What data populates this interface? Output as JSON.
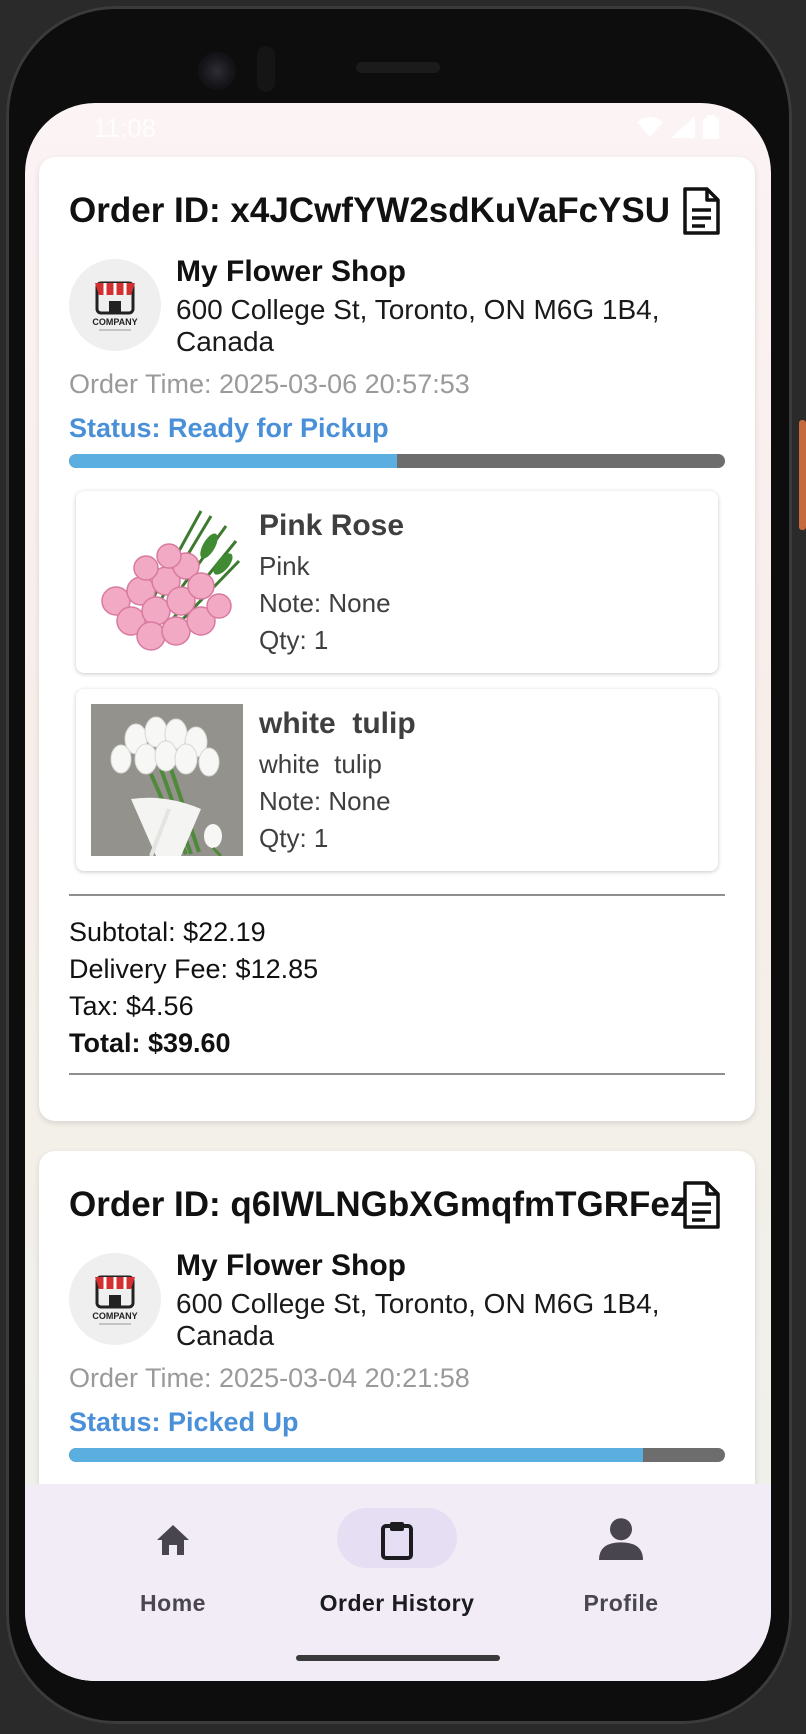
{
  "status_bar": {
    "time": "11:08"
  },
  "orders": [
    {
      "title": "Order ID: x4JCwfYW2sdKuVaFcYSU",
      "shop": {
        "name": "My Flower Shop",
        "address": "600 College St, Toronto, ON M6G 1B4, Canada",
        "logo_text": "COMPANY"
      },
      "order_time": "Order Time: 2025-03-06 20:57:53",
      "status": "Status: Ready for Pickup",
      "progress": 0.5,
      "items": [
        {
          "name": "Pink Rose",
          "variant": "Pink",
          "note": "Note: None",
          "qty": "Qty: 1"
        },
        {
          "name": "white  tulip",
          "variant": "white  tulip",
          "note": "Note: None",
          "qty": "Qty: 1"
        }
      ],
      "summary": {
        "subtotal": "Subtotal: $22.19",
        "delivery_fee": "Delivery Fee: $12.85",
        "tax": "Tax: $4.56",
        "total": "Total: $39.60"
      }
    },
    {
      "title": "Order ID: q6IWLNGbXGmqfmTGRFez",
      "shop": {
        "name": "My Flower Shop",
        "address": "600 College St, Toronto, ON M6G 1B4, Canada",
        "logo_text": "COMPANY"
      },
      "order_time": "Order Time: 2025-03-04 20:21:58",
      "status": "Status: Picked Up",
      "progress": 0.875
    }
  ],
  "bottom_nav": {
    "items": [
      {
        "label": "Home",
        "icon": "home-icon",
        "active": false
      },
      {
        "label": "Order History",
        "icon": "clipboard-icon",
        "active": true
      },
      {
        "label": "Profile",
        "icon": "person-icon",
        "active": false
      }
    ]
  },
  "colors": {
    "status_text": "#4a90d9",
    "progress_fill": "#5aaee0",
    "progress_track": "#6d6d6d",
    "nav_background": "#f1ecf6",
    "nav_active_pill": "#e6dff3"
  }
}
